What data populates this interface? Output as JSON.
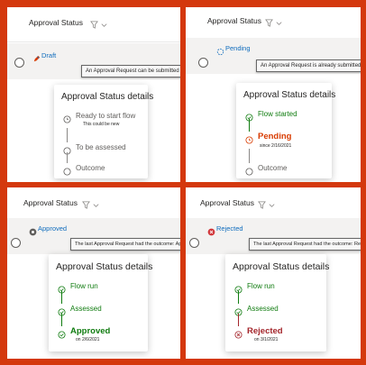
{
  "colors": {
    "border": "#d4380d",
    "green": "#107c10",
    "orange": "#d83b01",
    "red": "#a4262c",
    "gray": "#605e5c",
    "blue": "#0f6cbd"
  },
  "column_header": "Approval Status",
  "column_icons": [
    "filter-icon",
    "chevron-down-icon"
  ],
  "card_title": "Approval Status details",
  "panels": [
    {
      "status": {
        "label": "Draft",
        "icon": "pencil-icon"
      },
      "tooltip": "An Approval Request can be submitted",
      "steps": [
        {
          "label": "Ready to start flow",
          "sub": "This could be new",
          "icon": "clock-outline-icon"
        },
        {
          "label": "To be assessed",
          "sub": "",
          "icon": "circle-empty-icon"
        },
        {
          "label": "Outcome",
          "sub": "",
          "icon": "circle-empty-icon"
        }
      ]
    },
    {
      "status": {
        "label": "Pending",
        "icon": "spinner-icon"
      },
      "tooltip": "An Approval Request is already submitted",
      "steps": [
        {
          "label": "Flow started",
          "sub": "",
          "icon": "check-circle-icon"
        },
        {
          "label": "Pending",
          "sub": "since 2/16/2021",
          "icon": "clock-orange-icon"
        },
        {
          "label": "Outcome",
          "sub": "",
          "icon": "circle-empty-icon"
        }
      ]
    },
    {
      "status": {
        "label": "Approved",
        "icon": "gear-badge-icon"
      },
      "tooltip": "The last Approval Request had the outcome: Approved",
      "steps": [
        {
          "label": "Flow run",
          "sub": "",
          "icon": "check-circle-icon"
        },
        {
          "label": "Assessed",
          "sub": "",
          "icon": "check-circle-icon"
        },
        {
          "label": "Approved",
          "sub": "on 2/6/2021",
          "icon": "check-circle-icon"
        }
      ]
    },
    {
      "status": {
        "label": "Rejected",
        "icon": "x-badge-icon"
      },
      "tooltip": "The last Approval Request had the outcome: Rejected",
      "steps": [
        {
          "label": "Flow run",
          "sub": "",
          "icon": "check-circle-icon"
        },
        {
          "label": "Assessed",
          "sub": "",
          "icon": "check-circle-icon"
        },
        {
          "label": "Rejected",
          "sub": "on 3/1/2021",
          "icon": "x-circle-icon"
        }
      ]
    }
  ]
}
